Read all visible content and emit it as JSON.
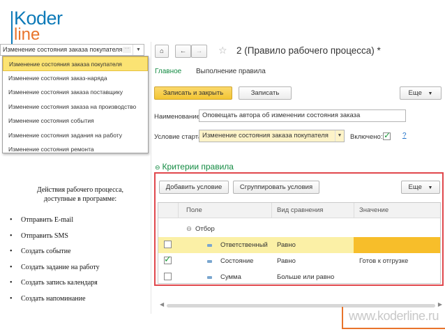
{
  "logo": {
    "line1": "Koder",
    "line2": "line",
    "brand_blue": "#0d7ab8",
    "brand_orange": "#e8742b"
  },
  "dropdown": {
    "value": "Изменение состояния заказа покупателя",
    "items": [
      "Изменение состояния заказа покупателя",
      "Изменение состояния заказ-наряда",
      "Изменение состояния заказа поставщику",
      "Изменение состояния заказа на производство",
      "Изменение состояния события",
      "Изменение состояния задания на работу",
      "Изменение состояния ремонта"
    ]
  },
  "actions": {
    "heading": "Действия рабочего процесса, доступные в программе:",
    "items": [
      "Отправить E-mail",
      "Отправить SMS",
      "Создать событие",
      "Создать задание на работу",
      "Создать запись календаря",
      "Создать напоминание"
    ]
  },
  "form": {
    "title": "2 (Правило рабочего процесса) *",
    "tabs": {
      "main": "Главное",
      "exec": "Выполнение правила"
    },
    "buttons": {
      "save_close": "Записать и закрыть",
      "save": "Записать",
      "more": "Еще"
    },
    "name_label": "Наименование:",
    "name_value": "Оповещать автора об изменении состояния заказа",
    "start_label": "Условие старта:",
    "start_value": "Изменение состояния заказа покупателя",
    "enabled_label": "Включено:",
    "help": "?",
    "criteria_title": "Критерии правила",
    "criteria_buttons": {
      "add": "Добавить условие",
      "group": "Сгруппировать условия",
      "more": "Еще"
    },
    "grid": {
      "headers": {
        "field": "Поле",
        "compare": "Вид сравнения",
        "value": "Значение"
      },
      "group_label": "Отбор",
      "rows": [
        {
          "checked": false,
          "field": "Ответственный",
          "compare": "Равно",
          "value": ""
        },
        {
          "checked": true,
          "field": "Состояние",
          "compare": "Равно",
          "value": "Готов к отгрузке"
        },
        {
          "checked": false,
          "field": "Сумма",
          "compare": "Больше или равно",
          "value": ""
        }
      ]
    }
  },
  "footer": {
    "url": "www.koderline.ru"
  },
  "colors": {
    "accent_green": "#128a41",
    "highlight_red": "#e0474c",
    "yellow": "#f3c532"
  }
}
